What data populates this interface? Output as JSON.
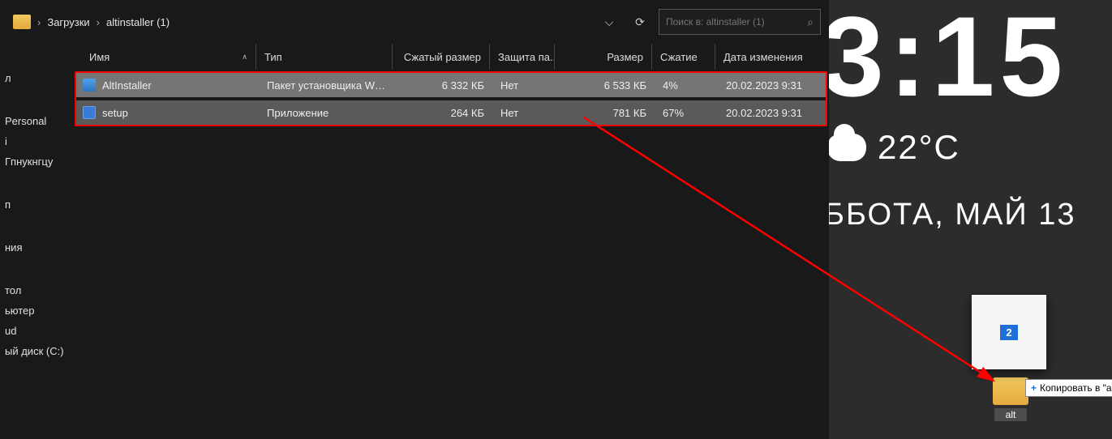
{
  "breadcrumb": {
    "parent": "Загрузки",
    "current": "altinstaller (1)"
  },
  "search": {
    "placeholder": "Поиск в: altinstaller (1)"
  },
  "sidebar": {
    "items": [
      "л",
      "",
      "Personal",
      "і",
      "Гпнукнгцу",
      "",
      "п",
      "",
      "ния",
      "",
      "тол",
      "ьютер",
      "ud",
      "ый диск (C:)"
    ]
  },
  "columns": {
    "name": "Имя",
    "type": "Тип",
    "compressed": "Сжатый размер",
    "protected": "Защита па...",
    "size": "Размер",
    "ratio": "Сжатие",
    "date": "Дата изменения"
  },
  "rows": [
    {
      "name": "AltInstaller",
      "type": "Пакет установщика Win...",
      "compressed": "6 332 КБ",
      "protected": "Нет",
      "size": "6 533 КБ",
      "ratio": "4%",
      "date": "20.02.2023 9:31",
      "icon": "msi"
    },
    {
      "name": "setup",
      "type": "Приложение",
      "compressed": "264 КБ",
      "protected": "Нет",
      "size": "781 КБ",
      "ratio": "67%",
      "date": "20.02.2023 9:31",
      "icon": "exe"
    }
  ],
  "desktop": {
    "clock": "3:15",
    "temp": "22°C",
    "day": "ББОТА, МАЙ 13",
    "drag_count": "2",
    "copy_tip": "Копировать в \"alt",
    "folder_label": "alt"
  }
}
